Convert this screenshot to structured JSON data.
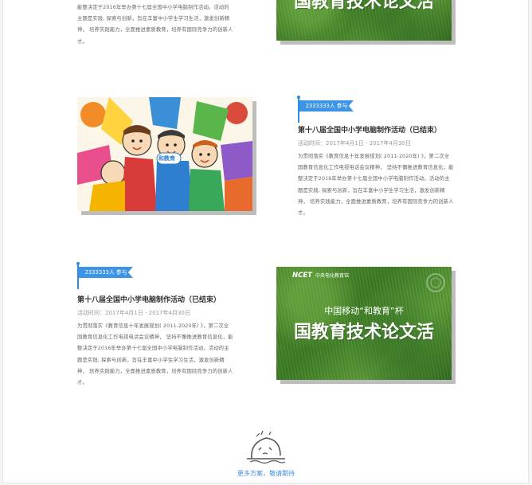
{
  "activities": [
    {
      "participants_label": "",
      "title": "",
      "time": "",
      "description": "能整决定于2016年举办第十七届全国中小学电脑制作活动。活动的主题是实践, 探索与创新，旨在丰富中小学生学习生活，激发创新精神， 培养实践能力，全面推进素质教育，培养有国际竞争力的创新人才。",
      "image_caption_main": "国教育技术论文活"
    },
    {
      "participants_label": "2333333人 参与",
      "title": "第十八届全国中小学电脑制作活动（已结束）",
      "time": "活动时间：2017年4月1日 - 2017年4月30日",
      "description": "为贯彻落实《教育信息十年发展规划( 2011-2020年) 》，第二次全国教育信息化工作电视电话会议精神， 坚持不懈推进教育信息化，能整决定于2016年举办第十七届全国中小学电脑制作活动。活动的主题是实践, 探索与创新，旨在丰富中小学生学习生活，激发创新精神， 培养实践能力，全面推进素质教育，培养有国际竞争力的创新人才。",
      "image_badge": "和教育"
    },
    {
      "participants_label": "2333333人 参与",
      "title": "第十八届全国中小学电脑制作活动（已结束）",
      "time": "活动时间：2017年4月1日 - 2017年4月30日",
      "description": "为贯彻落实《教育信息十年发展规划( 2011-2020年) 》，第二次全国教育信息化工作电视电话会议精神， 坚持不懈推进教育信息化，能整决定于2016年举办第十七届全国中小学电脑制作活动。活动的主题是实践, 探索与创新，旨在丰富中小学生学习生活，激发创新精神， 培养实践能力，全面推进素质教育，培养有国际竞争力的创新人才。",
      "image_logo": "NCET",
      "image_logo_sub": "中央电化教育馆",
      "image_caption_sub": "中国移动“和教育”杯",
      "image_caption_main": "国教育技术论文活"
    }
  ],
  "footer": {
    "more_text": "更多方案，敬请期待"
  },
  "colors": {
    "accent": "#3c94e6",
    "title_text": "#333333",
    "body_text": "#666666"
  }
}
